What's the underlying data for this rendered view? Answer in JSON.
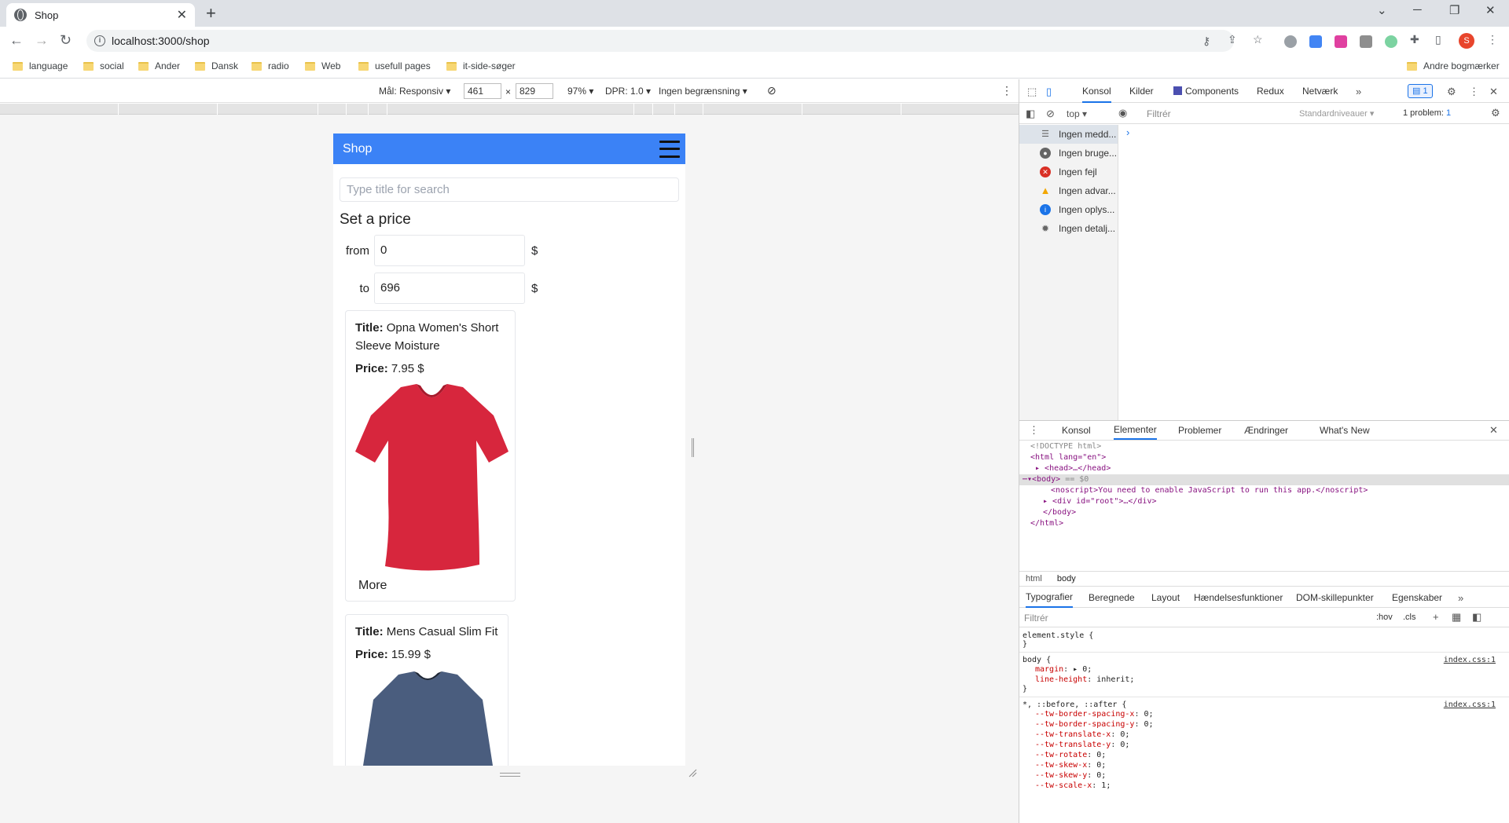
{
  "browser": {
    "tab_title": "Shop",
    "url": "localhost:3000/shop",
    "profile_initial": "S",
    "bookmarks": [
      "language",
      "social",
      "Ander",
      "Dansk",
      "radio",
      "Web",
      "usefull pages",
      "it-side-søger"
    ],
    "other_bookmarks": "Andre bogmærker"
  },
  "device_bar": {
    "target": "Mål: Responsiv",
    "width": "461",
    "height": "829",
    "zoom": "97%",
    "dpr": "DPR: 1.0",
    "throttle": "Ingen begrænsning"
  },
  "shop": {
    "brand": "Shop",
    "search_placeholder": "Type title for search",
    "price_heading": "Set a price",
    "from_label": "from",
    "from_value": "0",
    "to_label": "to",
    "to_value": "696",
    "currency": "$",
    "title_label": "Title:",
    "price_label": "Price:",
    "more_label": "More",
    "products": [
      {
        "title": "Opna Women's Short Sleeve Moisture",
        "price": "7.95 $",
        "color": "#d7263d"
      },
      {
        "title": "Mens Casual Slim Fit",
        "price": "15.99 $",
        "color": "#4a5d7e"
      }
    ]
  },
  "devtools": {
    "tabs": [
      "Konsol",
      "Kilder",
      "Components",
      "Redux",
      "Netværk"
    ],
    "issues_badge": "1",
    "context": "top",
    "filter_placeholder": "Filtrér",
    "levels": "Standardniveauer",
    "problems": "1 problem:",
    "problems_count": "1",
    "sidebar": [
      {
        "label": "Ingen medd...",
        "icon": "list-icon"
      },
      {
        "label": "Ingen bruge...",
        "icon": "user-icon"
      },
      {
        "label": "Ingen fejl",
        "icon": "error-icon"
      },
      {
        "label": "Ingen advar...",
        "icon": "warning-icon"
      },
      {
        "label": "Ingen oplys...",
        "icon": "info-icon"
      },
      {
        "label": "Ingen detalj...",
        "icon": "gear-icon"
      }
    ],
    "drawer_tabs": [
      "Konsol",
      "Elementer",
      "Problemer",
      "Ændringer",
      "What's New"
    ],
    "dom": {
      "doctype": "<!DOCTYPE html>",
      "html_open": "<html lang=\"en\">",
      "head": "<head>…</head>",
      "body_open": "<body>",
      "body_marker": "== $0",
      "noscript": "<noscript>You need to enable JavaScript to run this app.</noscript>",
      "root": "<div id=\"root\">…</div>",
      "body_close": "</body>",
      "html_close": "</html>"
    },
    "breadcrumbs": [
      "html",
      "body"
    ],
    "style_tabs": [
      "Typografier",
      "Beregnede",
      "Layout",
      "Hændelsesfunktioner",
      "DOM-skillepunkter",
      "Egenskaber"
    ],
    "styles_filter": "Filtrér",
    "hov": ":hov",
    "cls": ".cls",
    "rules": [
      {
        "selector": "element.style {",
        "source": "",
        "props": []
      },
      {
        "selector": "body {",
        "source": "index.css:1",
        "props": [
          [
            "margin",
            "▸ 0;"
          ],
          [
            "line-height",
            "inherit;"
          ]
        ]
      },
      {
        "selector": "*, ::before, ::after {",
        "source": "index.css:1",
        "props": [
          [
            "--tw-border-spacing-x",
            "0;"
          ],
          [
            "--tw-border-spacing-y",
            "0;"
          ],
          [
            "--tw-translate-x",
            "0;"
          ],
          [
            "--tw-translate-y",
            "0;"
          ],
          [
            "--tw-rotate",
            "0;"
          ],
          [
            "--tw-skew-x",
            "0;"
          ],
          [
            "--tw-skew-y",
            "0;"
          ],
          [
            "--tw-scale-x",
            "1;"
          ]
        ]
      }
    ]
  }
}
